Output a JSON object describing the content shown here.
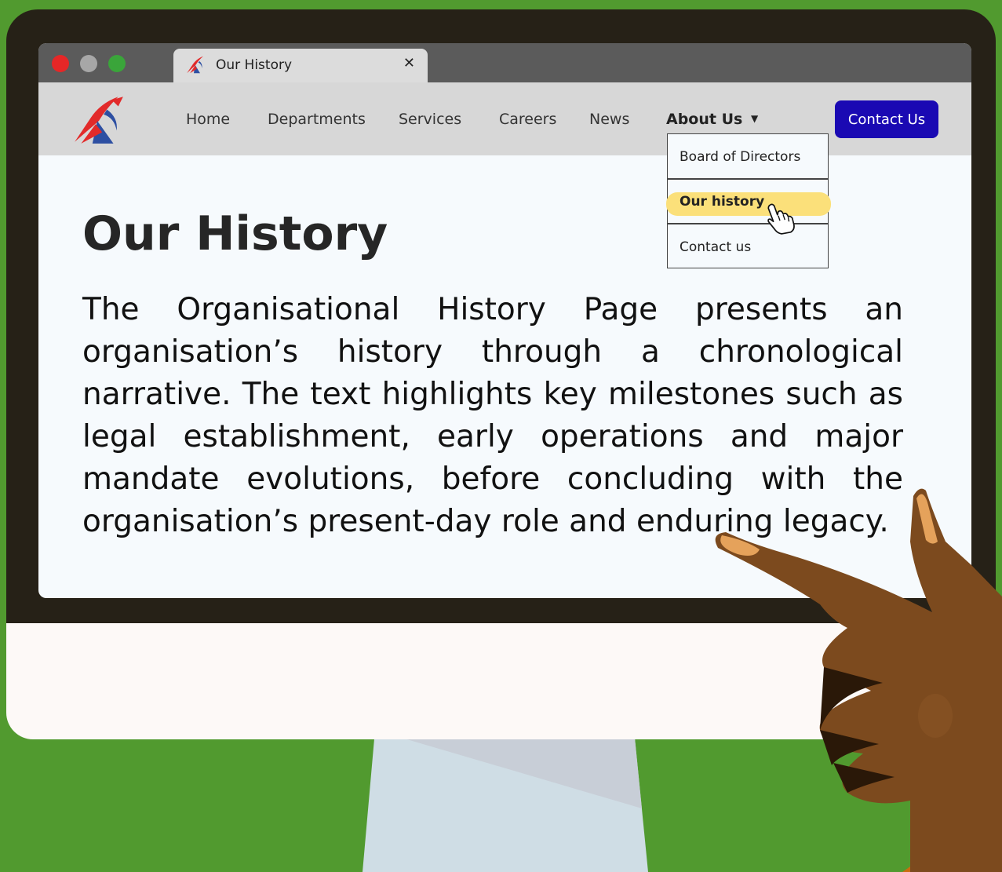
{
  "browser": {
    "window_controls": [
      "close",
      "minimize",
      "maximize"
    ],
    "tab": {
      "title": "Our History",
      "close_glyph": "✕",
      "icon": "site-logo-icon"
    }
  },
  "navbar": {
    "logo": "site-logo-icon",
    "items": [
      "Home",
      "Departments",
      "Services",
      "Careers",
      "News"
    ],
    "about": {
      "label": "About Us",
      "caret": "▼"
    },
    "contact_button": "Contact Us"
  },
  "dropdown": {
    "items": [
      "Board of Directors",
      "Our history",
      "Contact us"
    ],
    "active_item": "Our history"
  },
  "page": {
    "title": "Our History",
    "body": "The Organisational History Page presents an organisation’s history through a chronological narrative. The text highlights key milestones such as legal establishment, early operations and major mandate evolutions, before concluding with the organisation’s present-day role and enduring legacy."
  },
  "colors": {
    "background": "#519a2f",
    "bezel": "#262117",
    "contact_button": "#1a09b3",
    "highlight": "#fbe07a",
    "close_dot": "#e62727",
    "minimize_dot": "#a7a7a7",
    "maximize_dot": "#3aa53a"
  }
}
